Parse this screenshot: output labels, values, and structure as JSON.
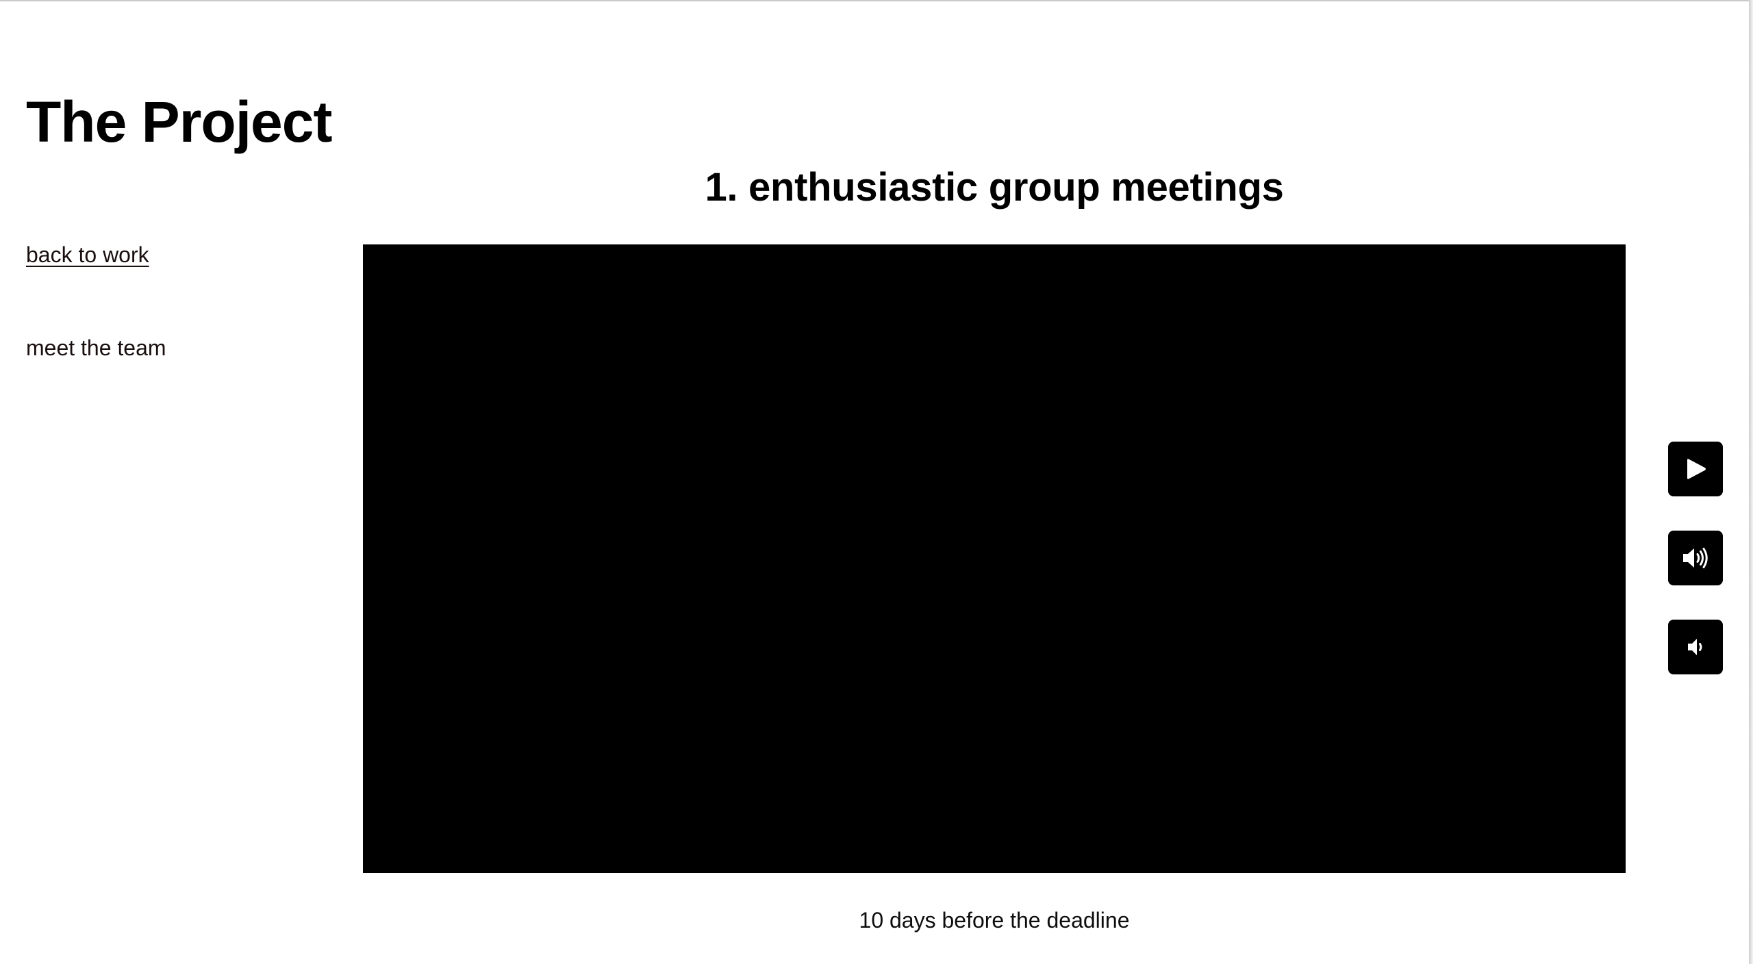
{
  "site": {
    "title": "The Project"
  },
  "nav": {
    "items": [
      {
        "label": "back to work",
        "underlined": true
      },
      {
        "label": "meet the team",
        "underlined": false
      }
    ]
  },
  "section": {
    "heading": "1. enthusiastic group meetings"
  },
  "video": {
    "caption": "10 days before the deadline"
  },
  "controls": [
    {
      "name": "play",
      "icon": "play-icon"
    },
    {
      "name": "volume-up",
      "icon": "volume-up-icon"
    },
    {
      "name": "volume-down",
      "icon": "volume-down-icon"
    }
  ],
  "colors": {
    "background": "#ffffff",
    "text": "#000000",
    "player": "#000000",
    "control_background": "#000000",
    "control_icon": "#ffffff"
  }
}
